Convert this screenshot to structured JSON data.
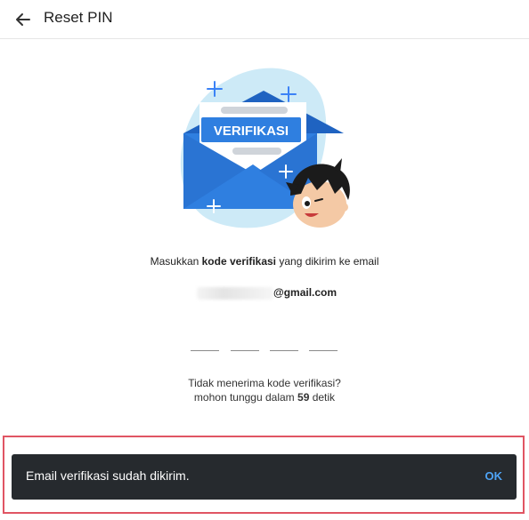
{
  "header": {
    "title": "Reset PIN",
    "back_icon": "arrow-left-icon"
  },
  "illustration": {
    "envelope_label": "VERIFIKASI",
    "colors": {
      "blob": "#cdeaf7",
      "envelope": "#2f7fe0",
      "envelope_dark": "#1f63c1",
      "accent": "#3b82f6"
    }
  },
  "instruction": {
    "prefix": "Masukkan ",
    "bold": "kode verifikasi",
    "suffix": " yang dikirim ke email"
  },
  "email": {
    "domain": "@gmail.com"
  },
  "otp": {
    "digits": [
      "",
      "",
      "",
      ""
    ]
  },
  "resend": {
    "line1": "Tidak menerima kode verifikasi?",
    "line2_prefix": "mohon tunggu dalam ",
    "seconds": "59",
    "line2_suffix": " detik"
  },
  "snackbar": {
    "message": "Email verifikasi sudah dikirim.",
    "action": "OK"
  },
  "colors": {
    "snackbar_bg": "#262a2e",
    "snackbar_action": "#4ea3f5",
    "highlight": "#e05563"
  }
}
